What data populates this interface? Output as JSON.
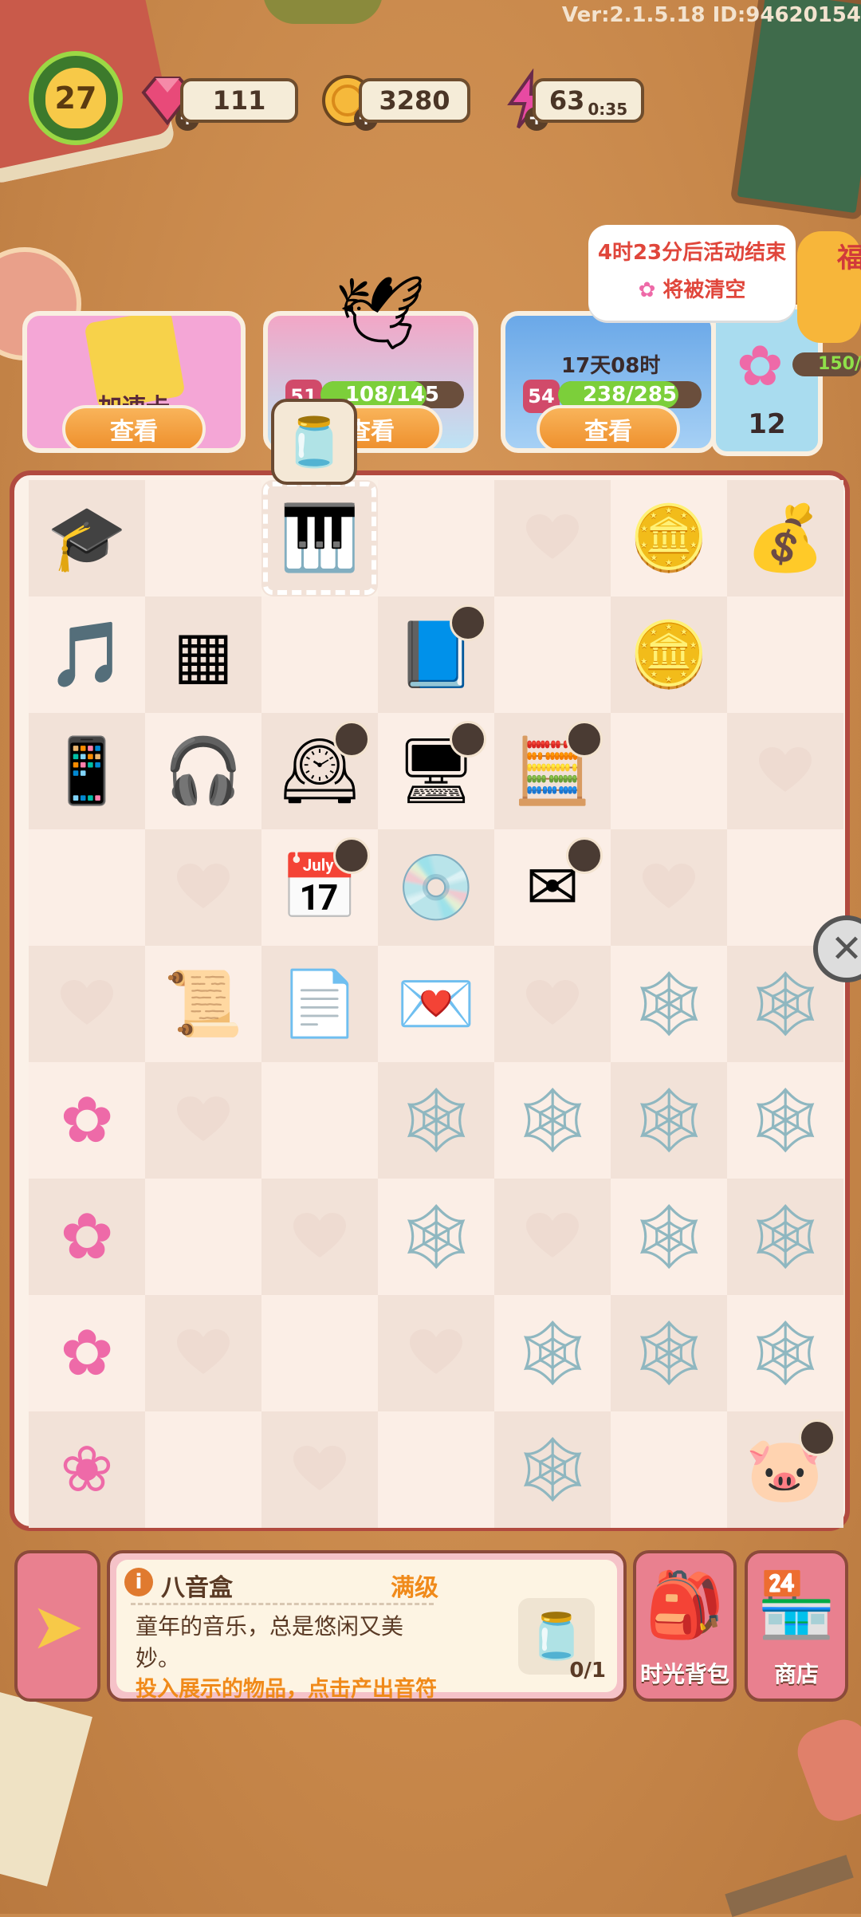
{
  "version": "Ver:2.1.5.18 ID:94620154",
  "top_bar": {
    "level": "27",
    "gems": "111",
    "coins": "3280",
    "energy": "63",
    "energy_timer": "0:35"
  },
  "event_cards": [
    {
      "name": "加速卡",
      "button": "查看"
    },
    {
      "level": "51",
      "progress": "108/145",
      "progress_fraction": 0.74,
      "button": "查看"
    },
    {
      "level": "54",
      "timer": "17天08时",
      "progress": "238/285",
      "progress_fraction": 0.84,
      "button": "查看"
    }
  ],
  "side_event": {
    "count": "12",
    "progress": "150/",
    "badge": "福"
  },
  "tooltip": {
    "line1": "4时23分后活动结束",
    "line2": "将被清空"
  },
  "board": {
    "rows": [
      [
        "graduation-cap",
        "",
        "music-box",
        "",
        "heart",
        "gold-coin",
        "gold-coins-pile"
      ],
      [
        "music-note",
        "circuit-board",
        "",
        "storybook",
        "",
        "gold-coins",
        ""
      ],
      [
        "tablet",
        "headphones",
        "grandfather-clock",
        "retro-computer",
        "calculator",
        "",
        "heart"
      ],
      [
        "",
        "heart",
        "desk-calendar",
        "cd-disc",
        "envelopes",
        "heart",
        ""
      ],
      [
        "heart",
        "letter-with-quill",
        "letters-stack",
        "love-letter",
        "heart",
        "cobweb-crane",
        "cobweb-letters"
      ],
      [
        "sakura-flower-big",
        "heart",
        "",
        "cobweb-crane",
        "cobweb-crane",
        "cobweb-crane",
        "cobweb-crane"
      ],
      [
        "sakura-flower-medium",
        "",
        "heart",
        "cobweb-crane",
        "heart",
        "cobweb-crane",
        "cobweb-crane"
      ],
      [
        "sakura-flower-small",
        "heart",
        "",
        "heart",
        "cobweb-crane",
        "cobweb-crane",
        "cobweb-crane"
      ],
      [
        "sakura-petals",
        "",
        "heart",
        "",
        "cobweb-crane",
        "",
        "piggy-bank"
      ]
    ]
  },
  "info_panel": {
    "title": "八音盒",
    "status": "满级",
    "description": "童年的音乐，总是悠闲又美妙。",
    "hint": "投入展示的物品，点击产出音符",
    "slot_count": "0/1"
  },
  "buttons": {
    "backpack": "时光背包",
    "shop": "商店"
  }
}
